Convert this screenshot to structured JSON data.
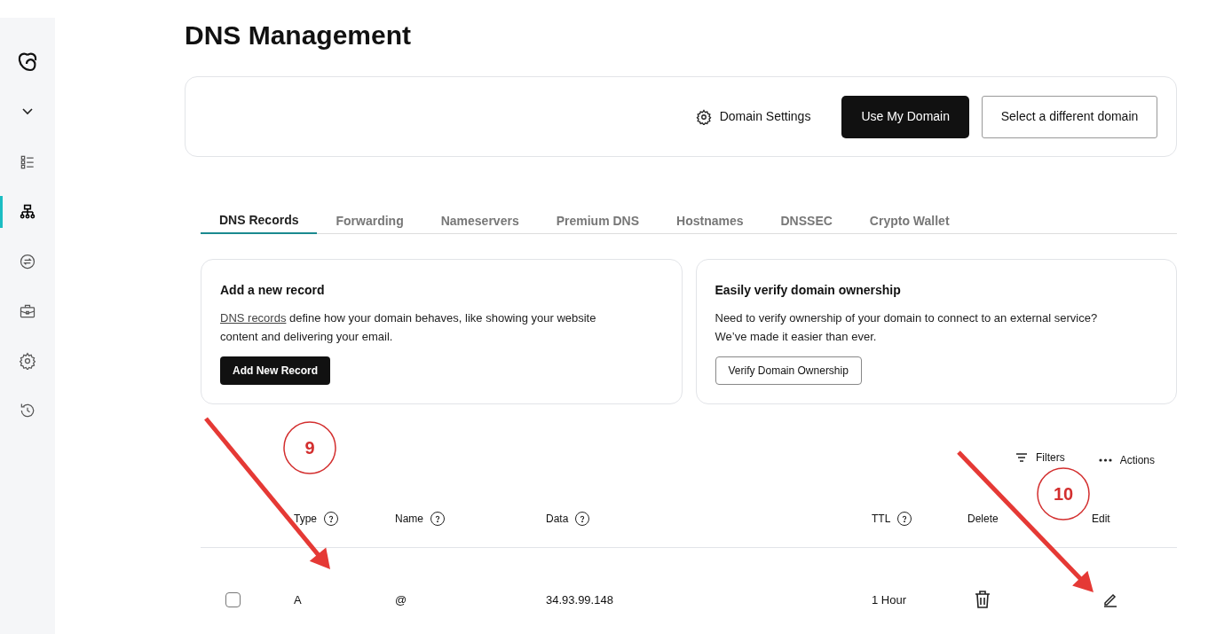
{
  "sidebar": {
    "nav_items": [
      {
        "selected": false
      },
      {
        "selected": true
      },
      {
        "selected": false
      },
      {
        "selected": false
      },
      {
        "selected": false
      },
      {
        "selected": false
      }
    ]
  },
  "page_title": "DNS Management",
  "domain_bar": {
    "settings_link": "Domain Settings",
    "primary_button": "Use My Domain",
    "secondary_button": "Select a different domain"
  },
  "tabs": [
    {
      "label": "DNS Records",
      "selected": true
    },
    {
      "label": "Forwarding",
      "selected": false
    },
    {
      "label": "Nameservers",
      "selected": false
    },
    {
      "label": "Premium DNS",
      "selected": false
    },
    {
      "label": "Hostnames",
      "selected": false
    },
    {
      "label": "DNSSEC",
      "selected": false
    },
    {
      "label": "Crypto Wallet",
      "selected": false
    }
  ],
  "cards": [
    {
      "title": "Add a new record",
      "link": "DNS records",
      "text": " define how your domain behaves, like showing your website content and delivering your email.",
      "button": "Add New Record",
      "kind": "primary"
    },
    {
      "title": "Easily verify domain ownership",
      "text": "Need to verify ownership of your domain to connect to an external service? We’ve made it easier than ever.",
      "button": "Verify Domain Ownership",
      "kind": "secondary"
    }
  ],
  "toolbar": {
    "filters": "Filters",
    "actions": "Actions"
  },
  "table": {
    "columns": [
      {
        "label": "Type",
        "help": true
      },
      {
        "label": "Name",
        "help": true
      },
      {
        "label": "Data",
        "help": true
      },
      {
        "label": "TTL",
        "help": true
      },
      {
        "label": "Delete",
        "help": false
      },
      {
        "label": "Edit",
        "help": false
      }
    ],
    "rows": [
      {
        "checked": false,
        "type": "A",
        "name": "@",
        "data": "34.93.99.148",
        "ttl": "1 Hour"
      }
    ]
  },
  "annotations": [
    {
      "label": "9"
    },
    {
      "label": "10"
    }
  ]
}
